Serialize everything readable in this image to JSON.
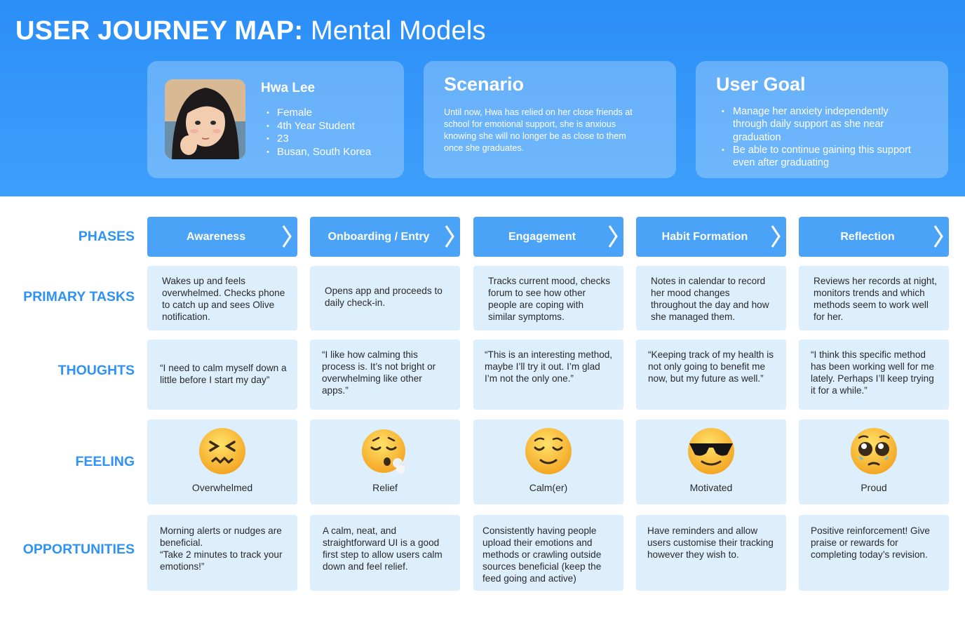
{
  "header": {
    "title_bold": "USER JOURNEY MAP:",
    "title_light": "Mental Models"
  },
  "persona": {
    "name": "Hwa Lee",
    "details": [
      "Female",
      "4th Year Student",
      "23",
      "Busan, South Korea"
    ]
  },
  "scenario": {
    "title": "Scenario",
    "body": "Until now, Hwa has relied on her close friends at school for emotional support, she is anxious knowing she will no longer be as close to them once she graduates."
  },
  "user_goal": {
    "title": "User Goal",
    "items": [
      "Manage her anxiety independently through daily support as she near graduation",
      "Be able to continue gaining this support even after graduating"
    ]
  },
  "row_labels": {
    "phases": "PHASES",
    "primary_tasks": "PRIMARY TASKS",
    "thoughts": "THOUGHTS",
    "feeling": "FEELING",
    "opportunities": "OPPORTUNITIES"
  },
  "phases": [
    "Awareness",
    "Onboarding / Entry",
    "Engagement",
    "Habit Formation",
    "Reflection"
  ],
  "primary_tasks": [
    "Wakes up and feels overwhelmed. Checks phone to catch up and sees Olive notification.",
    "Opens app and proceeds to daily check-in.",
    "Tracks current mood, checks forum to see how other people are coping with similar symptoms.",
    "Notes in calendar to record her mood changes throughout the day and how she managed them.",
    "Reviews her records at night, monitors trends and which methods seem to work well for her."
  ],
  "thoughts": [
    "“I need to calm myself down a little before I start my day”",
    "“I like how calming this process is. It’s not bright or overwhelming like other apps.”",
    "“This is an interesting method, maybe I’ll try it out. I’m glad I’m not the only one.”",
    "“Keeping track of my health is not only going to benefit me now, but my future as well.”",
    "“I think this specific method has been working well for me lately. Perhaps I’ll keep trying it for a while.”"
  ],
  "feelings": [
    {
      "label": "Overwhelmed",
      "icon": "confounded-face-icon"
    },
    {
      "label": "Relief",
      "icon": "exhaling-face-icon"
    },
    {
      "label": "Calm(er)",
      "icon": "relieved-face-icon"
    },
    {
      "label": "Motivated",
      "icon": "sunglasses-face-icon"
    },
    {
      "label": "Proud",
      "icon": "pleading-face-icon"
    }
  ],
  "opportunities": [
    "Morning alerts or nudges are beneficial.\n“Take 2 minutes to track your emotions!”",
    "A calm, neat, and straightforward UI is a good first step to  allow users calm down and feel relief.",
    "Consistently having people upload their emotions and methods or crawling outside sources beneficial (keep the feed going and active)",
    "Have reminders and allow users customise their tracking however they wish to.",
    "Positive reinforcement! Give praise or rewards for completing today’s revision."
  ],
  "colors": {
    "header_blue": "#2b8ef7",
    "label_blue": "#2e93f4",
    "phase_blue": "#4ba3f7",
    "cell_bg": "#ddeefd"
  }
}
